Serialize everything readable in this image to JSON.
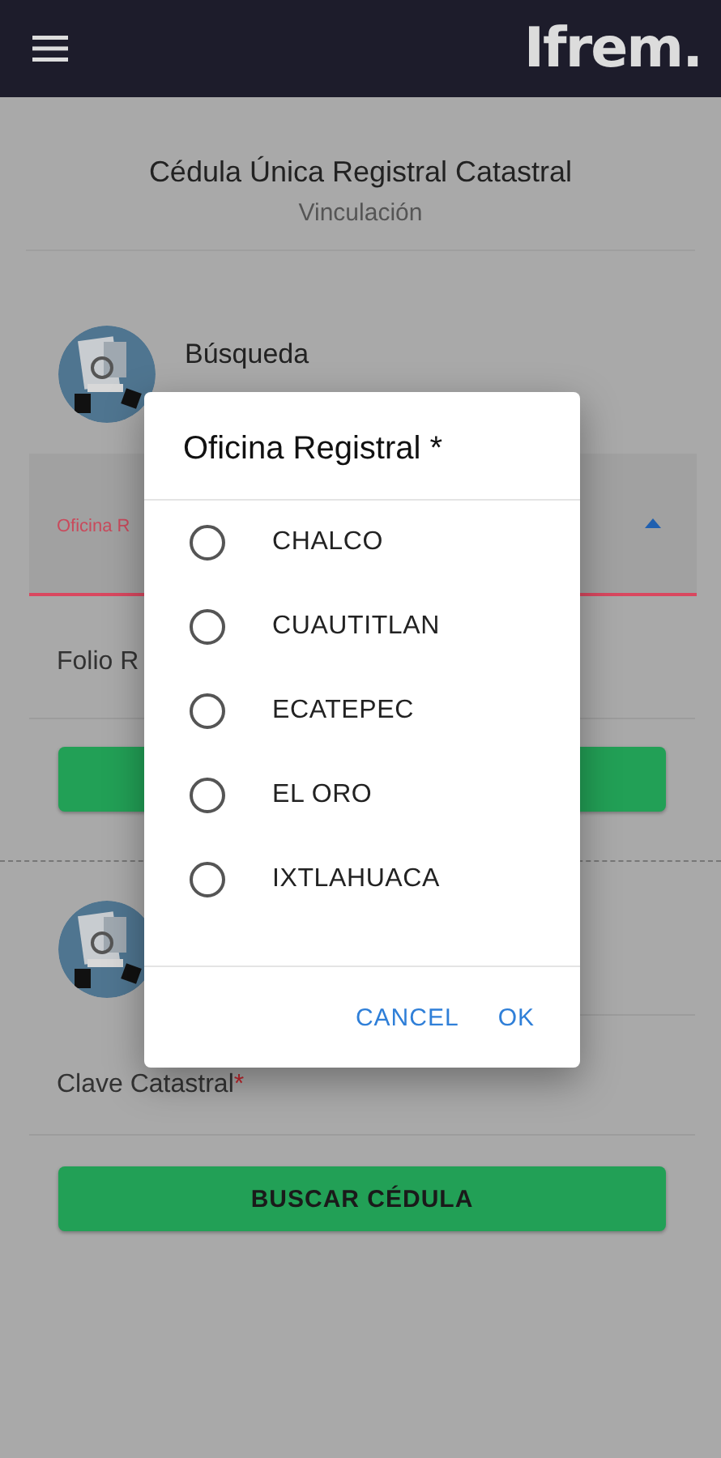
{
  "header": {
    "logo": "Ifrem."
  },
  "title": "Cédula Única Registral Catastral",
  "subtitle": "Vinculación",
  "search_section": {
    "heading": "Búsqueda",
    "field_label": "Oficina R",
    "field_expanded": true,
    "input_label": "Folio R"
  },
  "lower_section": {
    "input_label": "Clave Catastral",
    "required_mark": "*",
    "button": "BUSCAR CÉDULA"
  },
  "dialog": {
    "title": "Oficina Registral *",
    "options": [
      {
        "label": "CHALCO",
        "selected": false
      },
      {
        "label": "CUAUTITLAN",
        "selected": false
      },
      {
        "label": "ECATEPEC",
        "selected": false
      },
      {
        "label": "EL ORO",
        "selected": false
      },
      {
        "label": "IXTLAHUACA",
        "selected": false
      }
    ],
    "buttons": [
      "CANCEL",
      "OK"
    ]
  }
}
